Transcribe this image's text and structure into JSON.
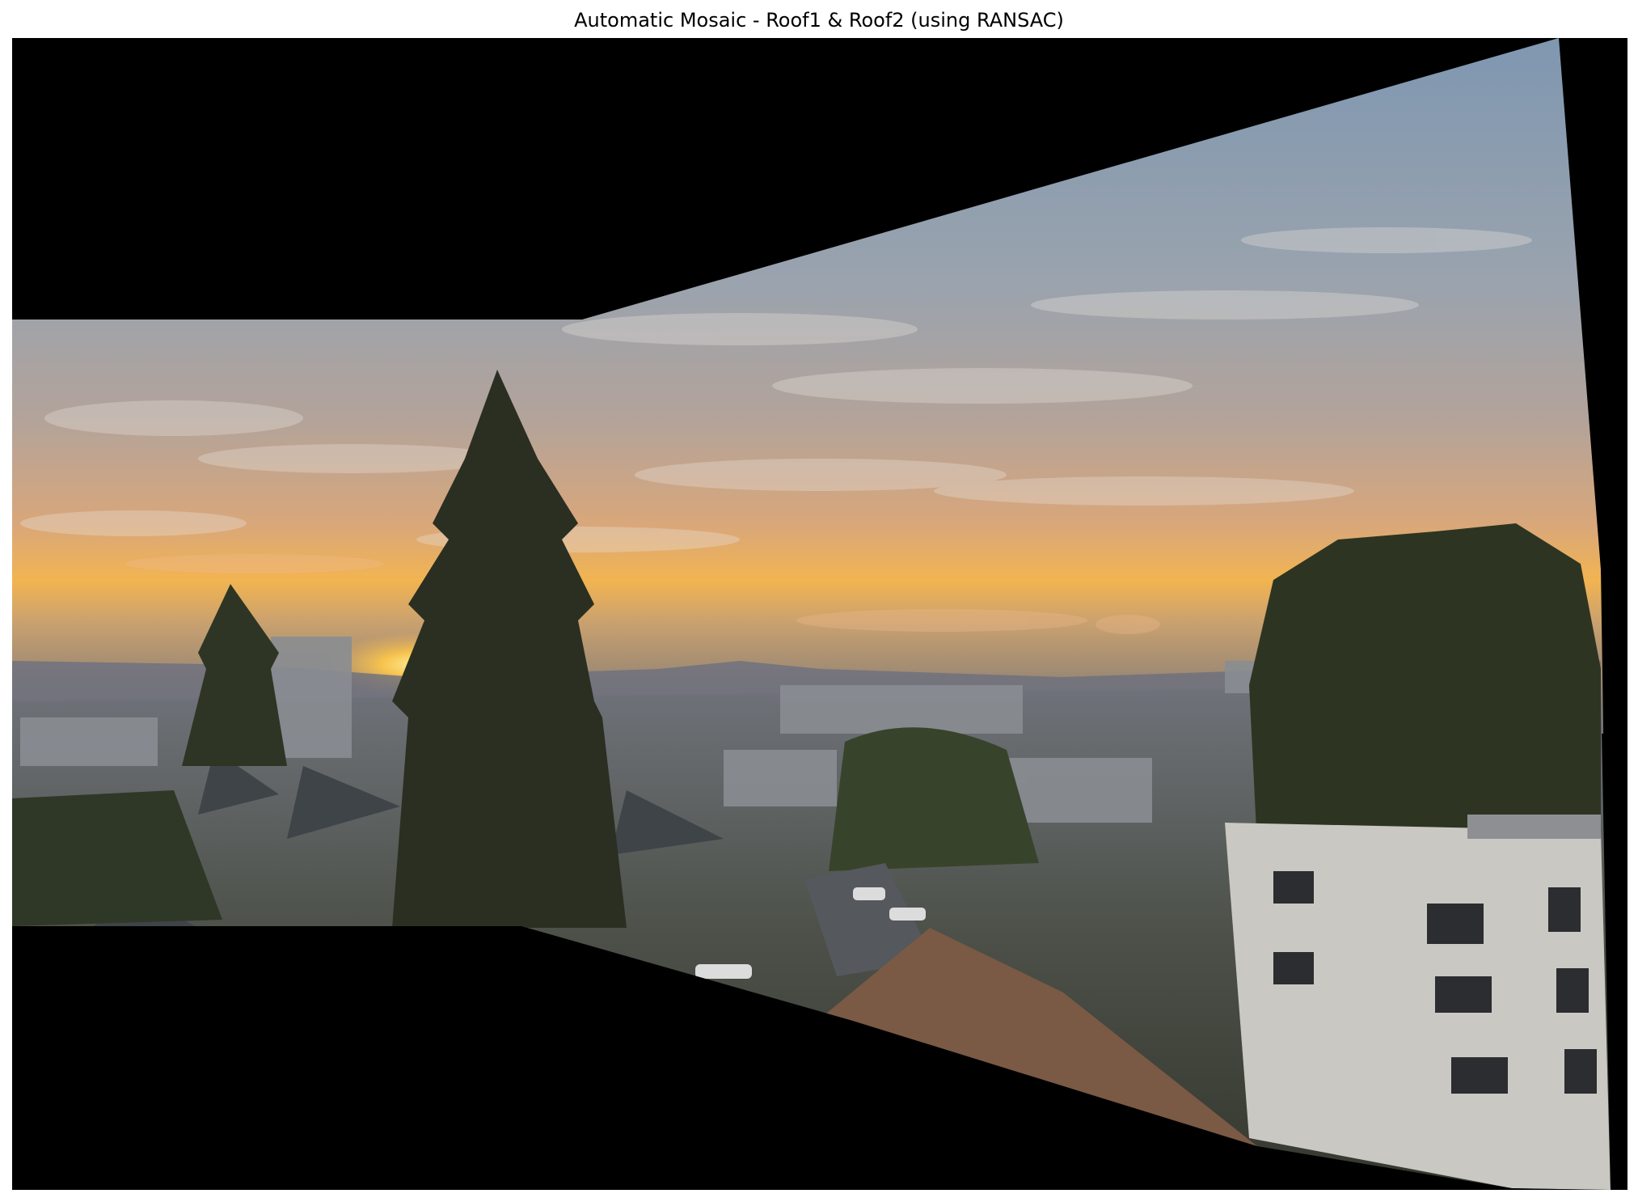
{
  "figure": {
    "title": "Automatic Mosaic - Roof1 & Roof2 (using RANSAC)"
  },
  "mosaic": {
    "background_color": "#000000",
    "sky_colors": {
      "upper": "#8da2b8",
      "mid": "#a79a98",
      "horizon": "#f3b24e",
      "sun": "#ffd24a"
    },
    "ground_colors": {
      "buildings": "#7a7c80",
      "trees": "#2d3522",
      "roof": "#7a5a44",
      "apartment": "#c9c8c2"
    }
  }
}
